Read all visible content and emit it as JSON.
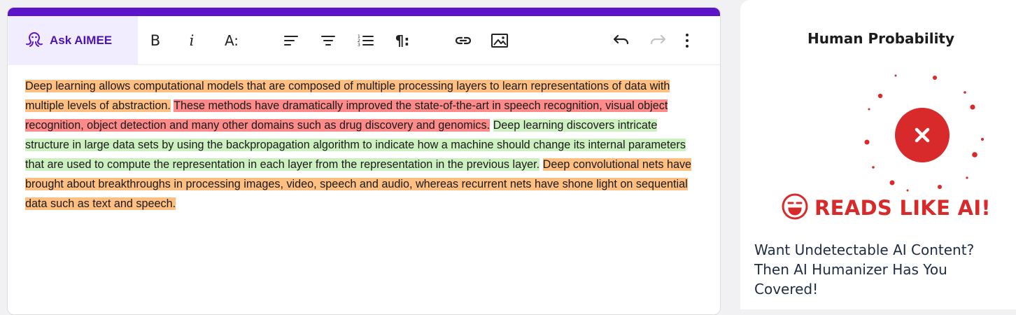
{
  "toolbar": {
    "ask_label": "Ask AIMEE",
    "bold_label": "B",
    "italic_label": "i",
    "font_size_label": "A:",
    "paragraph_label": "¶:"
  },
  "editor": {
    "segments": [
      {
        "text": "Deep learning allows computational models that are composed of multiple processing layers to learn representations of data with multiple levels of abstraction.",
        "highlight": "orange"
      },
      {
        "text": "These methods have dramatically improved the state-of-the-art in speech recognition, visual object recognition, object detection and many other domains such as drug discovery and genomics.",
        "highlight": "red"
      },
      {
        "text": "Deep learning discovers intricate structure in large data sets by using the backpropagation algorithm to indicate how a machine should change its internal parameters that are used to compute the representation in each layer from the representation in the previous layer.",
        "highlight": "green"
      },
      {
        "text": "Deep convolutional nets have brought about breakthroughs in processing images, video, speech and audio, whereas recurrent nets have shone light on sequential data such as text and speech.",
        "highlight": "orange"
      }
    ]
  },
  "sidebar": {
    "title": "Human Probability",
    "verdict": "READS LIKE AI!",
    "promo": "Want Undetectable AI Content? Then AI Humanizer Has You Covered!"
  },
  "colors": {
    "brand_purple": "#5b14c9",
    "highlight_orange": "#ffbf80",
    "highlight_red": "#ff8a8a",
    "highlight_green": "#cdf0c0",
    "verdict_red": "#d82a2a"
  },
  "icons": [
    "octopus-icon",
    "align-left-icon",
    "align-center-icon",
    "numbered-list-icon",
    "link-icon",
    "image-icon",
    "undo-icon",
    "redo-icon",
    "more-vertical-icon",
    "close-icon",
    "wink-face-icon"
  ]
}
